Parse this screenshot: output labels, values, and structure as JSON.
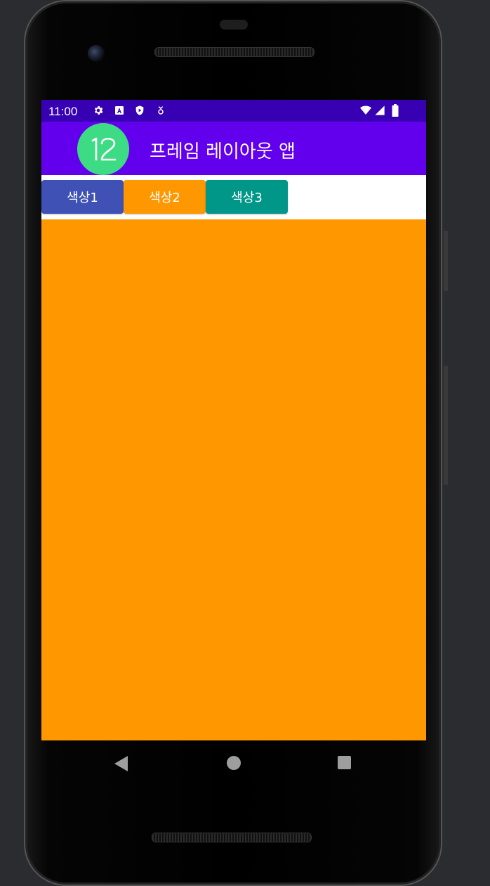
{
  "status_bar": {
    "time": "11:00",
    "background": "#3700b3",
    "left_icons": [
      "settings-icon",
      "text-a-icon",
      "play-protect-icon",
      "location-icon"
    ],
    "right_icons": [
      "wifi-icon",
      "signal-icon",
      "battery-icon"
    ]
  },
  "app_bar": {
    "title": "프레임 레이아웃 앱",
    "background": "#6200ee",
    "logo_text": "12",
    "logo_color": "#3ddc84"
  },
  "buttons": [
    {
      "label": "색상1",
      "color": "#3f51b5"
    },
    {
      "label": "색상2",
      "color": "#ff9800"
    },
    {
      "label": "색상3",
      "color": "#009688"
    }
  ],
  "frame": {
    "color": "#ff9800"
  },
  "nav_bar": {
    "buttons": [
      "back-icon",
      "home-icon",
      "recents-icon"
    ]
  }
}
